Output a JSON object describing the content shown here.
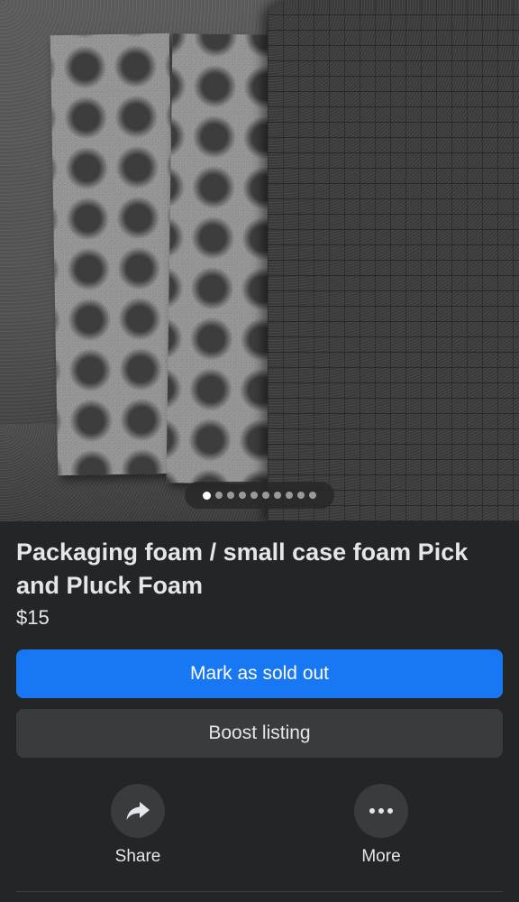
{
  "listing": {
    "title": "Packaging foam / small case foam Pick and Pluck Foam",
    "price": "$15",
    "photo_count": 10,
    "active_photo_index": 0
  },
  "buttons": {
    "primary_label": "Mark as sold out",
    "secondary_label": "Boost listing"
  },
  "actions": {
    "share_label": "Share",
    "share_icon": "share-arrow-icon",
    "more_label": "More",
    "more_icon": "ellipsis-icon"
  },
  "colors": {
    "background": "#242526",
    "primary": "#1877f2",
    "secondary": "#3a3b3c",
    "text": "#e4e6eb"
  }
}
